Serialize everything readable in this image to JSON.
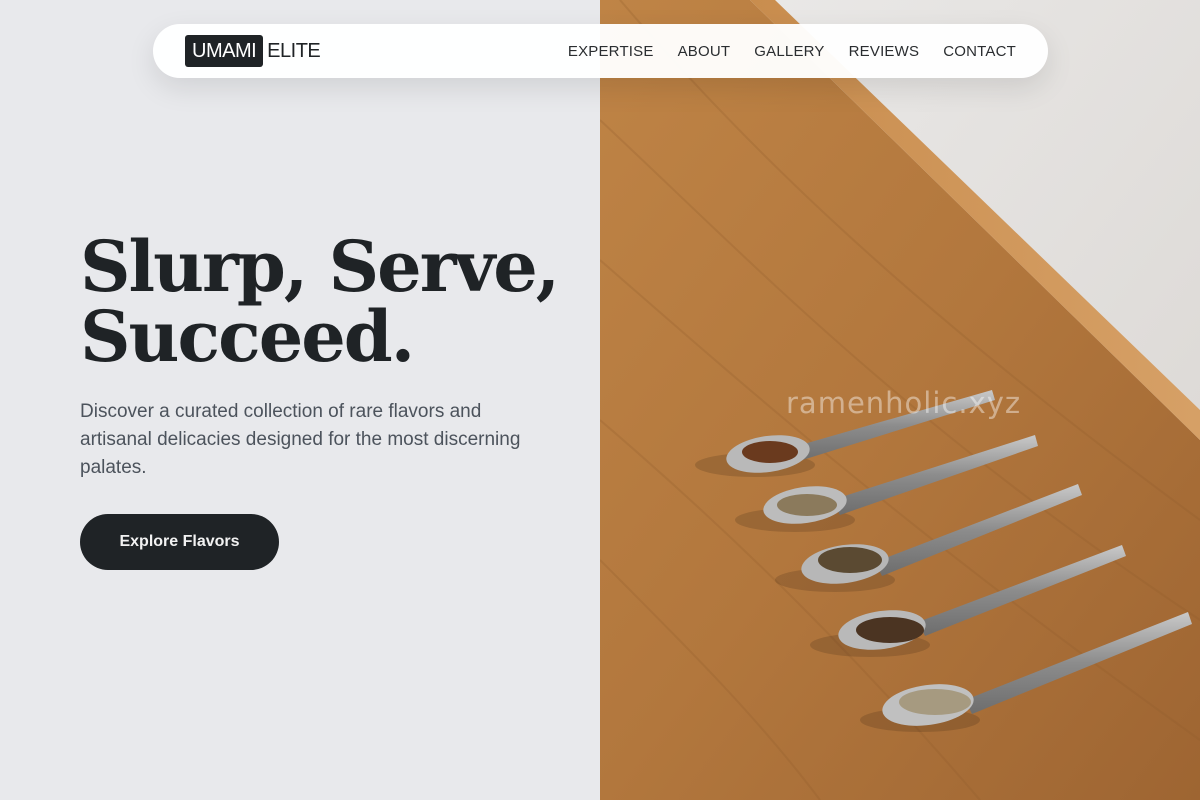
{
  "brand": {
    "badge": "UMAMI",
    "text": "ELITE"
  },
  "nav": {
    "items": [
      {
        "label": "EXPERTISE"
      },
      {
        "label": "ABOUT"
      },
      {
        "label": "GALLERY"
      },
      {
        "label": "REVIEWS"
      },
      {
        "label": "CONTACT"
      }
    ]
  },
  "hero": {
    "headline_line1": "Slurp, Serve,",
    "headline_line2": "Succeed.",
    "description": "Discover a curated collection of rare flavors and artisanal delicacies designed for the most discerning palates.",
    "cta_label": "Explore Flavors"
  },
  "photo": {
    "watermark": "ramenholic.xyz"
  },
  "colors": {
    "background": "#e8e9ec",
    "text_dark": "#1f2326",
    "text_muted": "#4c535c",
    "button_bg": "#1f2326",
    "wood": "#b47a3e"
  }
}
